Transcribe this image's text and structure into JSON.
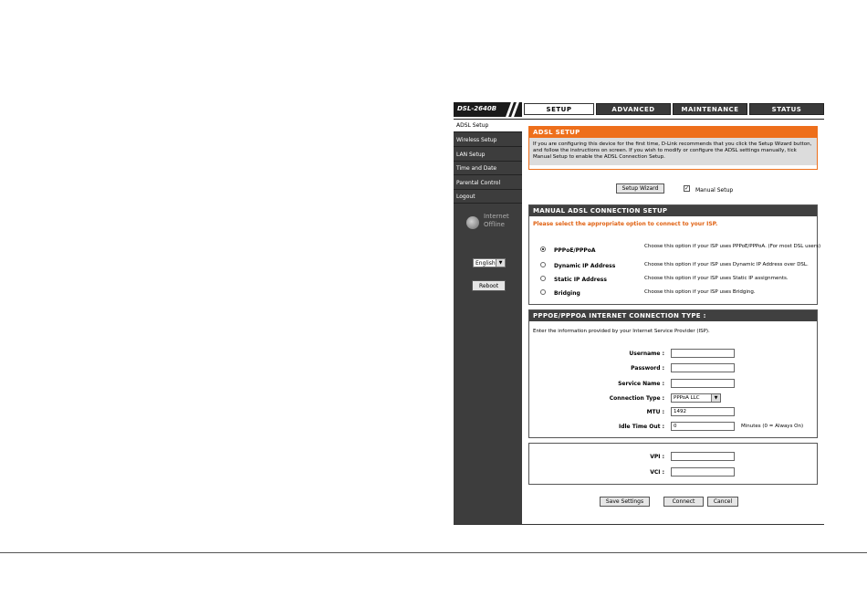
{
  "header": {
    "model": "DSL-2640B",
    "tabs": [
      {
        "label": "SETUP",
        "active": true
      },
      {
        "label": "ADVANCED",
        "active": false
      },
      {
        "label": "MAINTENANCE",
        "active": false
      },
      {
        "label": "STATUS",
        "active": false
      }
    ]
  },
  "sidebar": {
    "items": [
      {
        "label": "ADSL Setup",
        "active": true
      },
      {
        "label": "Wireless Setup"
      },
      {
        "label": "LAN Setup"
      },
      {
        "label": "Time and Date"
      },
      {
        "label": "Parental Control"
      },
      {
        "label": "Logout"
      }
    ],
    "status_line1": "Internet",
    "status_line2": "Offline",
    "language": "English",
    "reboot_label": "Reboot"
  },
  "intro": {
    "title": "ADSL SETUP",
    "description": "If you are configuring this device for the first time, D-Link recommends that you click the Setup Wizard button, and follow the instructions on screen. If you wish to modify or configure the ADSL settings manually, tick Manual Setup to enable the ADSL Connection Setup.",
    "wizard_label": "Setup Wizard",
    "manual_label": "Manual Setup",
    "manual_checked": true
  },
  "manual": {
    "title": "MANUAL ADSL CONNECTION SETUP",
    "prompt": "Please select the appropriate option to connect to your ISP.",
    "options": [
      {
        "label": "PPPoE/PPPoA",
        "desc": "Choose this option if your ISP uses PPPoE/PPPoA. (For most DSL users)",
        "selected": true
      },
      {
        "label": "Dynamic IP Address",
        "desc": "Choose this option if your ISP uses Dynamic IP Address over DSL.",
        "selected": false
      },
      {
        "label": "Static IP Address",
        "desc": "Choose this option if your ISP uses Static IP assignments.",
        "selected": false
      },
      {
        "label": "Bridging",
        "desc": "Choose this option if your ISP uses Bridging.",
        "selected": false
      }
    ]
  },
  "pppoe": {
    "title": "PPPOE/PPPOA INTERNET CONNECTION TYPE :",
    "intro": "Enter the information provided by your Internet Service Provider (ISP).",
    "username_label": "Username :",
    "username": "",
    "password_label": "Password :",
    "password": "",
    "service_label": "Service Name :",
    "service": "",
    "conn_type_label": "Connection Type :",
    "conn_type": "PPPoA LLC",
    "mtu_label": "MTU :",
    "mtu": "1492",
    "idle_label": "Idle Time Out :",
    "idle": "0",
    "idle_hint": "Minutes (0 = Always On)"
  },
  "vc": {
    "vpi_label": "VPI :",
    "vpi": "",
    "vci_label": "VCI :",
    "vci": ""
  },
  "actions": {
    "save": "Save Settings",
    "connect": "Connect",
    "cancel": "Cancel"
  }
}
